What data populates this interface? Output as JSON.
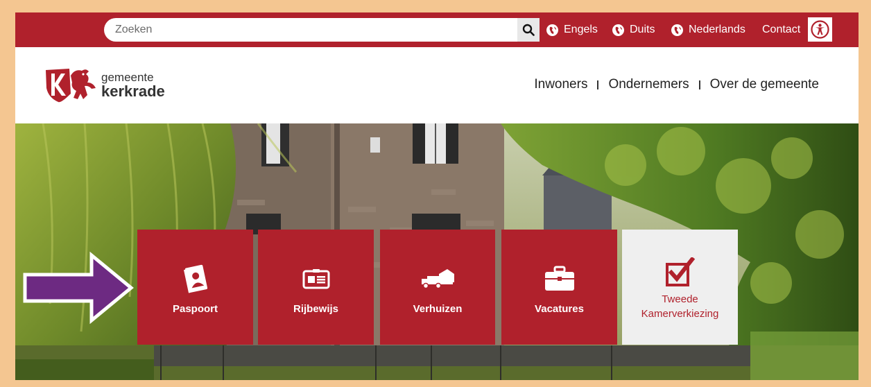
{
  "topbar": {
    "search": {
      "placeholder": "Zoeken",
      "button_icon": "search-icon"
    },
    "languages": [
      {
        "label": "Engels",
        "icon": "globe-icon"
      },
      {
        "label": "Duits",
        "icon": "globe-icon"
      },
      {
        "label": "Nederlands",
        "icon": "globe-icon"
      }
    ],
    "contact_label": "Contact",
    "accessibility_icon": "accessibility-icon"
  },
  "header": {
    "logo": {
      "line1": "gemeente",
      "line2": "kerkrade"
    },
    "nav": [
      "Inwoners",
      "Ondernemers",
      "Over de gemeente"
    ]
  },
  "hero": {
    "tiles": [
      {
        "label": "Paspoort",
        "icon": "passport-icon"
      },
      {
        "label": "Rijbewijs",
        "icon": "id-card-icon"
      },
      {
        "label": "Verhuizen",
        "icon": "moving-truck-icon"
      },
      {
        "label": "Vacatures",
        "icon": "briefcase-icon"
      },
      {
        "label_line1": "Tweede",
        "label_line2": "Kamerverkiezing",
        "icon": "ballot-checkbox-icon"
      }
    ],
    "annotation_icon": "arrow-right-icon"
  },
  "colors": {
    "brand_red": "#b0212c",
    "page_border": "#f4c691",
    "arrow_purple": "#6d2a82",
    "light_tile": "#efefef"
  }
}
